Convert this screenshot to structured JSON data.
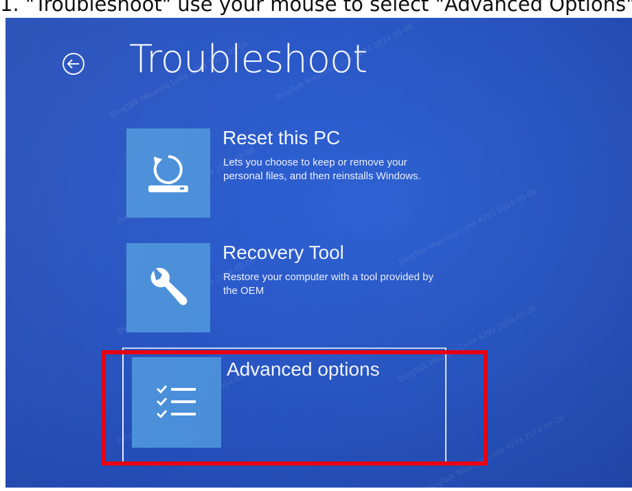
{
  "caption": "1. \"Troubleshoot\" use your mouse to select \"Advanced Options\"",
  "header": {
    "back_icon": "arrow-left-circle-icon",
    "title": "Troubleshoot"
  },
  "options": [
    {
      "title": "Reset this PC",
      "description": "Lets you choose to keep or remove your personal files, and then reinstalls Windows.",
      "icon": "reset-pc-icon"
    },
    {
      "title": "Recovery Tool",
      "description": "Restore your computer with a tool provided by the OEM",
      "icon": "wrench-icon"
    },
    {
      "title": "Advanced options",
      "description": "",
      "icon": "checklist-icon"
    }
  ],
  "watermark": "DingTalk Mauricio Luna 4293 2024-05-06",
  "colors": {
    "screen_bg": "#2a57c6",
    "tile": "#4a8fd9",
    "highlight": "#e60012",
    "text": "#f3f6ff"
  }
}
